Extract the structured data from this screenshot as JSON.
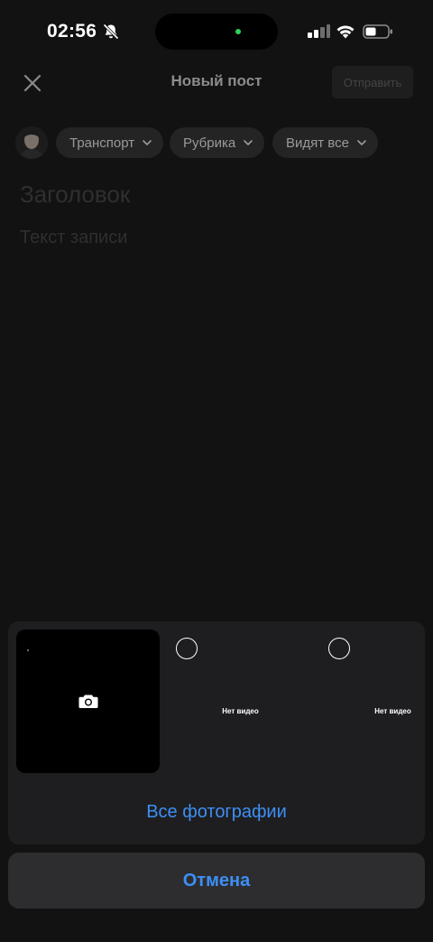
{
  "status_bar": {
    "time": "02:56",
    "indicator_color": "#30d158"
  },
  "header": {
    "title": "Новый пост",
    "send_label": "Отправить"
  },
  "chips": [
    {
      "label": "Транспорт"
    },
    {
      "label": "Рубрика"
    },
    {
      "label": "Видят все"
    }
  ],
  "editor": {
    "title_placeholder": "Заголовок",
    "body_placeholder": "Текст записи"
  },
  "media_picker": {
    "tiles": [
      {
        "type": "camera",
        "icon": "camera-icon"
      },
      {
        "type": "video",
        "label": "Нет видео"
      },
      {
        "type": "video",
        "label": "Нет видео"
      }
    ],
    "all_photos_label": "Все фотографии"
  },
  "cancel_label": "Отмена",
  "colors": {
    "background": "#121212",
    "accent": "#3d8ff5",
    "sheet": "#1e1e20"
  }
}
